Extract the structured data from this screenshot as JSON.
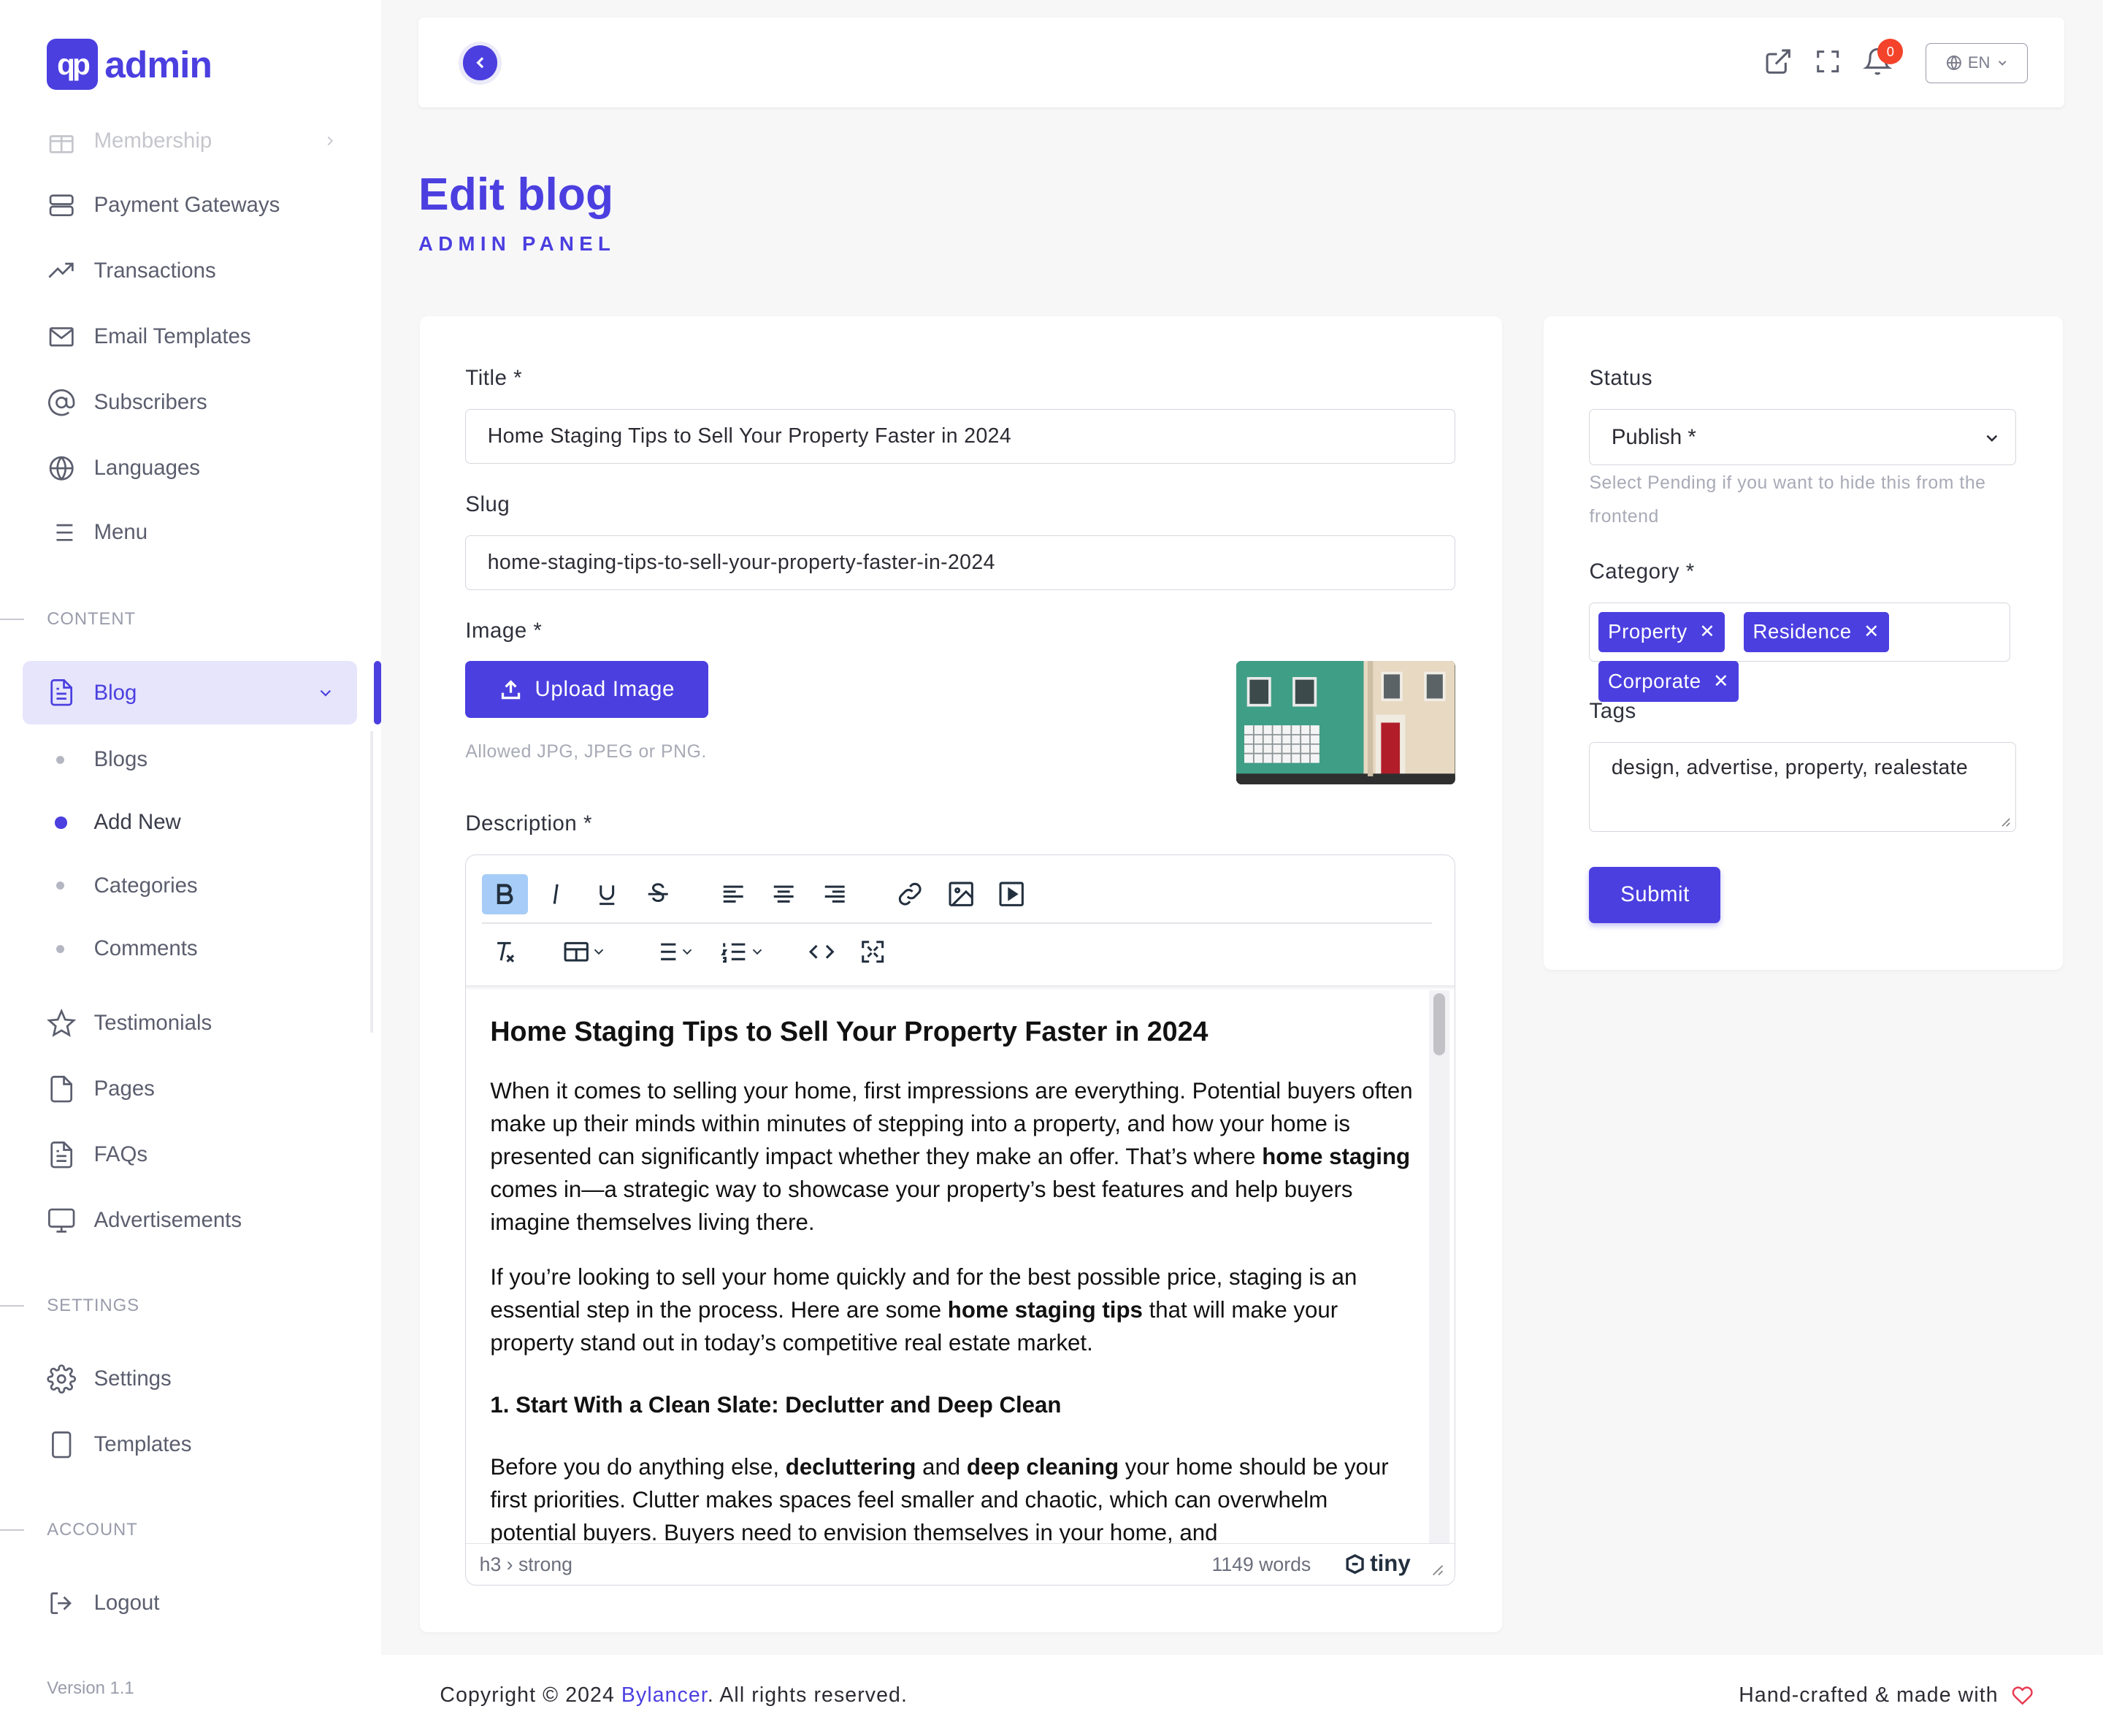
{
  "app": {
    "logo_mark": "qp",
    "logo_text": "admin",
    "version": "Version 1.1"
  },
  "sidebar": {
    "items": [
      {
        "label": "Membership",
        "icon": "gift-icon"
      },
      {
        "label": "Payment Gateways",
        "icon": "server-icon"
      },
      {
        "label": "Transactions",
        "icon": "trending-up-icon"
      },
      {
        "label": "Email Templates",
        "icon": "mail-icon"
      },
      {
        "label": "Subscribers",
        "icon": "at-sign-icon"
      },
      {
        "label": "Languages",
        "icon": "globe-icon"
      },
      {
        "label": "Menu",
        "icon": "list-icon"
      }
    ],
    "content_section": "CONTENT",
    "blog": {
      "label": "Blog",
      "icon": "file-text-icon",
      "submenu": [
        "Blogs",
        "Add New",
        "Categories",
        "Comments"
      ],
      "active_sub": "Add New"
    },
    "content_items": [
      {
        "label": "Testimonials",
        "icon": "star-icon"
      },
      {
        "label": "Pages",
        "icon": "file-icon"
      },
      {
        "label": "FAQs",
        "icon": "file-text-icon"
      },
      {
        "label": "Advertisements",
        "icon": "monitor-icon"
      }
    ],
    "settings_section": "SETTINGS",
    "settings_items": [
      {
        "label": "Settings",
        "icon": "gear-icon"
      },
      {
        "label": "Templates",
        "icon": "tablet-icon"
      }
    ],
    "account_section": "ACCOUNT",
    "account_items": [
      {
        "label": "Logout",
        "icon": "logout-icon"
      }
    ]
  },
  "topbar": {
    "notification_count": "0",
    "language": "EN"
  },
  "page": {
    "title": "Edit blog",
    "subtitle": "ADMIN PANEL"
  },
  "form": {
    "title_label": "Title *",
    "title_value": "Home Staging Tips to Sell Your Property Faster in 2024",
    "slug_label": "Slug",
    "slug_value": "home-staging-tips-to-sell-your-property-faster-in-2024",
    "image_label": "Image *",
    "upload_label": "Upload Image",
    "image_help": "Allowed JPG, JPEG or PNG.",
    "description_label": "Description *"
  },
  "editor": {
    "heading": "Home Staging Tips to Sell Your Property Faster in 2024",
    "p1_a": "When it comes to selling your home, first impressions are everything. Potential buyers often make up their minds within minutes of stepping into a property, and how your home is presented can significantly impact whether they make an offer. That’s where ",
    "p1_b": "home staging",
    "p1_c": " comes in—a strategic way to showcase your property’s best features and help buyers imagine themselves living there.",
    "p2_a": "If you’re looking to sell your home quickly and for the best possible price, staging is an essential step in the process. Here are some ",
    "p2_b": "home staging tips",
    "p2_c": " that will make your property stand out in today’s competitive real estate market.",
    "h4": "1. Start With a Clean Slate: Declutter and Deep Clean",
    "p3_a": "Before you do anything else, ",
    "p3_b": "decluttering",
    "p3_c": " and ",
    "p3_d": "deep cleaning",
    "p3_e": " your home should be your first priorities. Clutter makes spaces feel smaller and chaotic, which can overwhelm potential buyers. Buyers need to envision themselves in your home, and",
    "path": "h3 › strong",
    "word_count": "1149 words",
    "brand": "tiny"
  },
  "side": {
    "status_label": "Status",
    "status_value": "Publish *",
    "status_help": "Select Pending if you want to hide this from the frontend",
    "category_label": "Category *",
    "categories": [
      "Property",
      "Residence",
      "Corporate"
    ],
    "tags_label": "Tags",
    "tags_value": "design, advertise, property, realestate",
    "submit_label": "Submit"
  },
  "footer": {
    "copyright_prefix": "Copyright © 2024 ",
    "brand": "Bylancer",
    "copyright_suffix": ". All rights reserved.",
    "right_text": "Hand-crafted & made with"
  },
  "colors": {
    "accent": "#4b3fe0",
    "badge": "#f4432b",
    "heart": "#e8384f"
  }
}
